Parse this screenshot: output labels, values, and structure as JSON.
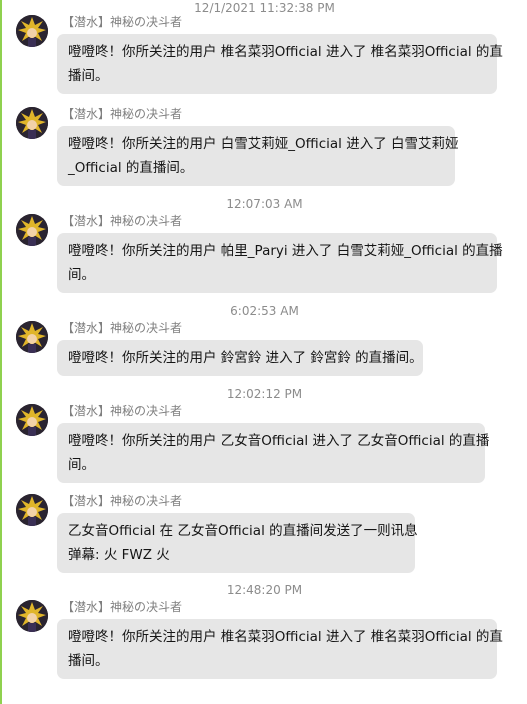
{
  "timestamps": [
    "12/1/2021 11:32:38 PM",
    "12:07:03 AM",
    "6:02:53 AM",
    "12:02:12 PM",
    "12:48:20 PM"
  ],
  "messages": [
    {
      "sender": "【潜水】神秘の决斗者",
      "lines": [
        "噔噔咚！你所关注的用户 椎名菜羽Official 进入了 椎名菜羽Official 的直",
        "播间。"
      ]
    },
    {
      "sender": "【潜水】神秘の决斗者",
      "lines": [
        "噔噔咚！你所关注的用户 白雪艾莉娅_Official 进入了 白雪艾莉娅",
        "_Official 的直播间。"
      ]
    },
    {
      "sender": "【潜水】神秘の决斗者",
      "lines": [
        "噔噔咚！你所关注的用户 帕里_Paryi 进入了 白雪艾莉娅_Official 的直播",
        "间。"
      ]
    },
    {
      "sender": "【潜水】神秘の决斗者",
      "lines": [
        "噔噔咚！你所关注的用户 鈴宮鈴 进入了 鈴宮鈴 的直播间。"
      ]
    },
    {
      "sender": "【潜水】神秘の决斗者",
      "lines": [
        "噔噔咚！你所关注的用户 乙女音Official 进入了 乙女音Official 的直播",
        "间。"
      ]
    },
    {
      "sender": "【潜水】神秘の决斗者",
      "lines": [
        "乙女音Official 在 乙女音Official 的直播间发送了一则讯息",
        "弹幕: 火 FWZ 火"
      ]
    },
    {
      "sender": "【潜水】神秘の决斗者",
      "lines": [
        "噔噔咚！你所关注的用户 椎名菜羽Official 进入了 椎名菜羽Official 的直",
        "播间。"
      ]
    }
  ]
}
